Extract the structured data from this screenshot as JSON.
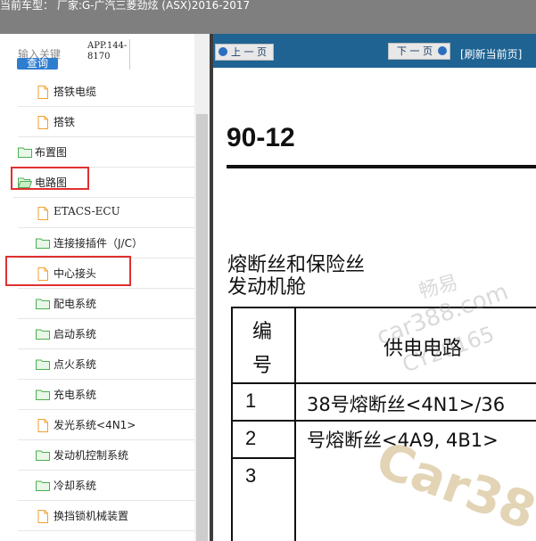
{
  "topbar": {
    "title": "当前车型： 厂家:G-广汽三菱劲炫 (ASX)2016-2017"
  },
  "search": {
    "label": "输入关键",
    "button": "查询",
    "app_line1": "APP.144-",
    "app_line2": "8170"
  },
  "tree": {
    "items": [
      {
        "label": "搭铁电缆",
        "icon": "document-icon"
      },
      {
        "label": "搭铁",
        "icon": "document-icon"
      },
      {
        "label": "布置图",
        "icon": "folder-icon"
      },
      {
        "label": "电路图",
        "icon": "folder-open-icon"
      },
      {
        "label": "ETACS-ECU",
        "icon": "document-icon"
      },
      {
        "label": "连接接插件（J/C）",
        "icon": "folder-icon"
      },
      {
        "label": "中心接头",
        "icon": "document-icon"
      },
      {
        "label": "配电系统",
        "icon": "folder-icon"
      },
      {
        "label": "启动系统",
        "icon": "folder-icon"
      },
      {
        "label": "点火系统",
        "icon": "folder-icon"
      },
      {
        "label": "充电系统",
        "icon": "folder-icon"
      },
      {
        "label": "发光系统<4N1>",
        "icon": "document-icon"
      },
      {
        "label": "发动机控制系统",
        "icon": "folder-icon"
      },
      {
        "label": "冷却系统",
        "icon": "folder-icon"
      },
      {
        "label": "换挡锁机械装置",
        "icon": "document-icon"
      }
    ]
  },
  "nav": {
    "prev": "上 一 页",
    "next": "下 一 页",
    "refresh": "[刷新当前页]"
  },
  "doc": {
    "page_number": "90-12",
    "heading_line1": "熔断丝和保险丝",
    "heading_line2": "发动机舱",
    "table": {
      "col1_header_line1": "编",
      "col1_header_line2": "号",
      "col2_header": "供电电路",
      "rows": [
        {
          "num": "1",
          "text": "38号熔断丝<4N1>/36"
        },
        {
          "num": "2",
          "text": "号熔断丝<4A9, 4B1>"
        },
        {
          "num": "3",
          "text": ""
        }
      ]
    }
  },
  "watermarks": {
    "wm1": "畅易",
    "wm2": "car388.com",
    "wm3": "CY20165",
    "wm4": "Car38"
  },
  "colors": {
    "nav_bg": "#1f6392",
    "topbar_bg": "#7f7f7f",
    "highlight": "#e03030",
    "folder": "#4caf50",
    "doc_icon": "#f0a030"
  }
}
